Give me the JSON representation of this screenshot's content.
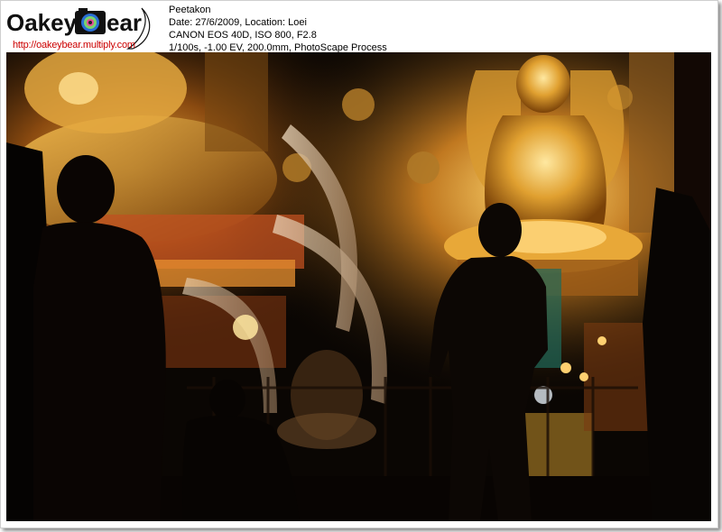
{
  "watermark": {
    "brand": "OakeyBear",
    "url": "http://oakeybear.multiply.com"
  },
  "photo_info": {
    "author": "Peetakon",
    "date_location": "Date: 27/6/2009, Location: Loei",
    "camera": "CANON EOS 40D, ISO 800, F2.8",
    "exposure": "1/100s, -1.00 EV, 200.0mm, PhotoScape Process"
  },
  "colors": {
    "gold": "#e8a830",
    "bright_gold": "#ffd870",
    "dark": "#0a0603",
    "url_red": "#cc0000"
  }
}
